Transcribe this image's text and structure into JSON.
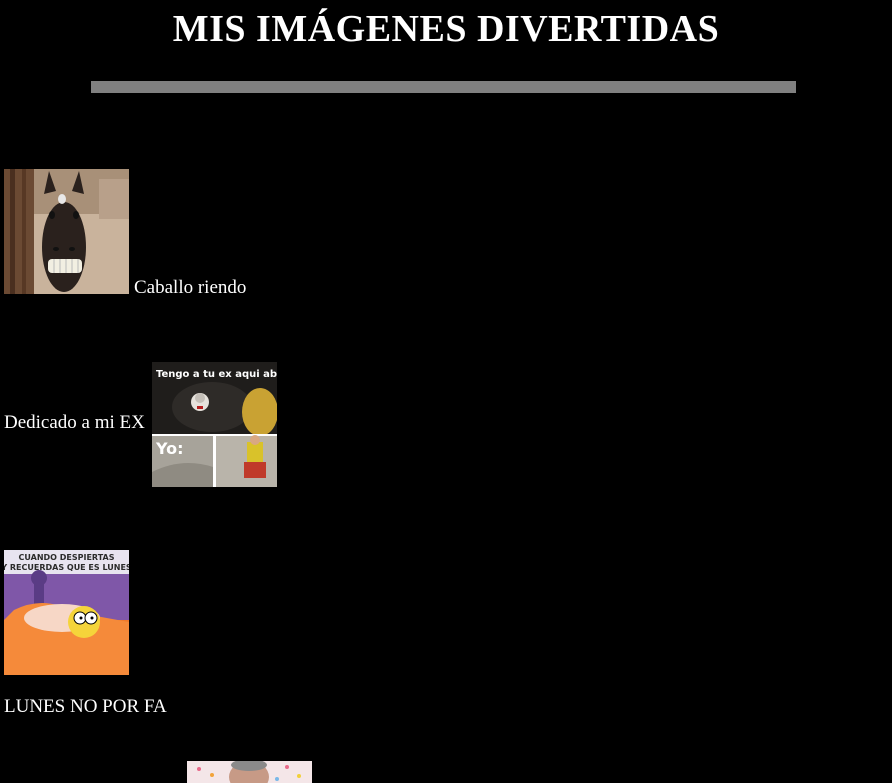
{
  "page": {
    "title": "MIS IMÁGENES DIVERTIDAS"
  },
  "items": [
    {
      "caption": "Caballo riendo",
      "image_alt": "laughing-horse-image"
    },
    {
      "caption": "Dedicado a mi EX",
      "image_alt": "pennywise-meme-image",
      "meme_top_text": "Tengo a tu ex aqui abajo",
      "meme_bottom_text": "Yo:"
    },
    {
      "caption": "LUNES NO POR FA",
      "image_alt": "homer-monday-meme-image",
      "meme_text_line1": "CUANDO DESPIERTAS",
      "meme_text_line2": "Y RECUERDAS QUE ES LUNES"
    },
    {
      "caption": "",
      "image_alt": "man-with-hearts-image"
    }
  ]
}
